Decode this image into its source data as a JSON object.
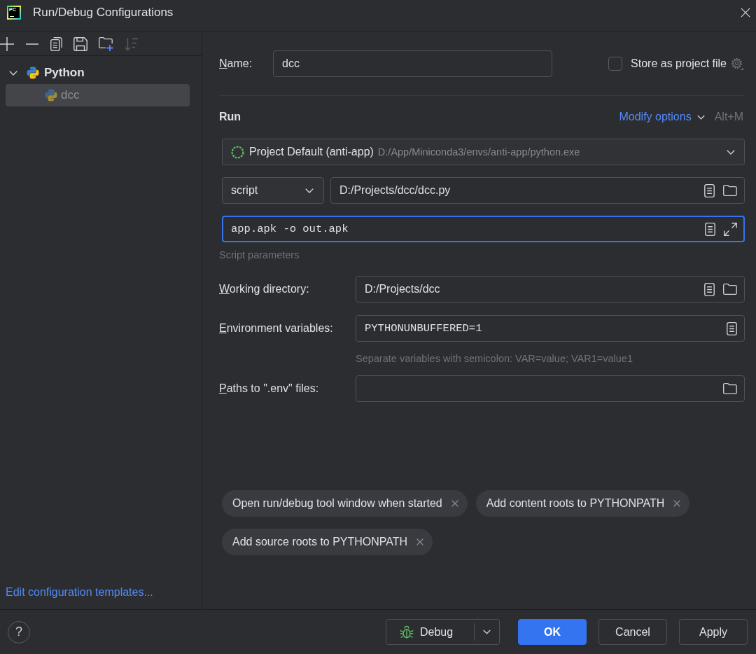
{
  "window": {
    "logo_text": "PC",
    "title": "Run/Debug Configurations"
  },
  "sidebar": {
    "toolbar": [
      {
        "kind": "add",
        "disabled": false
      },
      {
        "kind": "remove",
        "disabled": false
      },
      {
        "kind": "copy",
        "disabled": false
      },
      {
        "kind": "save",
        "disabled": false
      },
      {
        "kind": "new-folder",
        "disabled": false
      },
      {
        "kind": "sort",
        "disabled": true
      }
    ],
    "tree": [
      {
        "label": "Python",
        "expanded": true,
        "selected": false,
        "temporary": false,
        "children": [
          {
            "label": "dcc",
            "selected": true,
            "temporary": true
          }
        ]
      }
    ],
    "templates_link": "Edit configuration templates..."
  },
  "config": {
    "name": {
      "label": "Name:",
      "value": "dcc",
      "focused": false
    },
    "store_as_project_file": {
      "label": "Store as project file",
      "checked": false
    },
    "run": {
      "heading": "Run",
      "modify_options": "Modify options",
      "shortcut": "Alt+M",
      "interpreter": {
        "name": "Project Default (anti-app)",
        "path": "D:/App/Miniconda3/envs/anti-app/python.exe"
      },
      "script_type": "script",
      "script_path": {
        "value": "D:/Projects/dcc/dcc.py",
        "focused": false
      },
      "script_parameters": {
        "value": "app.apk -o out.apk",
        "caption": "Script parameters",
        "focused": true
      },
      "fields": [
        {
          "kind": "directory",
          "label": "Working directory:",
          "value": "D:/Projects/dcc",
          "focused": false
        },
        {
          "kind": "env",
          "label": "Environment variables:",
          "value": "PYTHONUNBUFFERED=1",
          "hint": "Separate variables with semicolon: VAR=value; VAR1=value1",
          "focused": false
        },
        {
          "kind": "files",
          "label": "Paths to \".env\" files:",
          "focused": false
        }
      ]
    },
    "options": [
      {
        "label": "Open run/debug tool window when started"
      },
      {
        "label": "Add content roots to PYTHONPATH"
      },
      {
        "label": "Add source roots to PYTHONPATH"
      }
    ]
  },
  "footer": {
    "help": "?",
    "buttons": [
      {
        "kind": "debug",
        "label": "Debug"
      },
      {
        "kind": "default",
        "label": "OK"
      },
      {
        "kind": "plain",
        "label": "Cancel"
      },
      {
        "kind": "plain",
        "label": "Apply"
      }
    ]
  }
}
